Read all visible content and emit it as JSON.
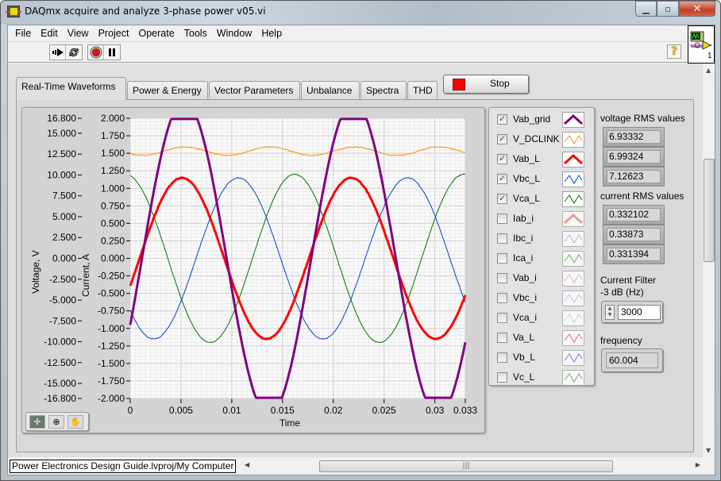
{
  "window": {
    "title": "DAQmx acquire and analyze 3-phase power v05.vi",
    "icon": "labview-vi-icon",
    "controls": {
      "minimize": "minimize-icon",
      "maximize": "maximize-icon",
      "close": "close-icon"
    }
  },
  "menu": [
    "File",
    "Edit",
    "View",
    "Project",
    "Operate",
    "Tools",
    "Window",
    "Help"
  ],
  "toolbar": {
    "buttons": [
      "run-arrow-icon",
      "run-continuously-icon",
      "abort-icon",
      "pause-icon"
    ],
    "help": "?",
    "connector_number": "1"
  },
  "tabs": [
    {
      "label": "Real-Time Waveforms",
      "active": true
    },
    {
      "label": "Power & Energy",
      "active": false
    },
    {
      "label": "Vector Parameters",
      "active": false
    },
    {
      "label": "Unbalance",
      "active": false
    },
    {
      "label": "Spectra",
      "active": false
    },
    {
      "label": "THD",
      "active": false
    }
  ],
  "stop_button": {
    "label": "Stop",
    "led_color": "#ff0000"
  },
  "graph": {
    "palette_tools": [
      "cursor-tool-icon",
      "zoom-tool-icon",
      "pan-hand-icon"
    ]
  },
  "chart_data": {
    "type": "line",
    "title": "",
    "xlabel": "Time",
    "ylabel_left": "Voltage, V",
    "ylabel_right": "Current, A",
    "xlim": [
      0,
      0.033
    ],
    "ylim_voltage": [
      -16.8,
      16.8
    ],
    "ylim_current": [
      -2.0,
      2.0
    ],
    "x_ticks": [
      "0",
      "0.005",
      "0.01",
      "0.015",
      "0.02",
      "0.025",
      "0.03",
      "0.033"
    ],
    "y_ticks_voltage": [
      "16.800",
      "15.000",
      "12.500",
      "10.000",
      "7.500",
      "5.000",
      "2.500",
      "0.000",
      "-2.500",
      "-5.000",
      "-7.500",
      "-10.000",
      "-12.500",
      "-15.000",
      "-16.800"
    ],
    "y_ticks_current": [
      "2.000",
      "1.750",
      "1.500",
      "1.250",
      "1.000",
      "0.750",
      "0.500",
      "0.250",
      "0.000",
      "-0.250",
      "-0.500",
      "-0.750",
      "-1.000",
      "-1.250",
      "-1.500",
      "-1.750",
      "-2.000"
    ],
    "grid": true,
    "frequency_hz": 60.004,
    "series": [
      {
        "name": "Vab_grid",
        "color": "#800080",
        "axis": "current",
        "amplitude": 2.0,
        "offset": 0,
        "phase_deg": -25,
        "clipped": true,
        "width": 3
      },
      {
        "name": "V_DCLINK",
        "color": "#ff8c00",
        "axis": "current",
        "amplitude": 0.06,
        "offset": 1.53,
        "phase_deg": 0,
        "harmonic": 2,
        "width": 1
      },
      {
        "name": "Vab_L",
        "color": "#ff0000",
        "axis": "current",
        "amplitude": 1.15,
        "offset": 0,
        "phase_deg": -20,
        "width": 3
      },
      {
        "name": "Vbc_L",
        "color": "#0040d0",
        "axis": "current",
        "amplitude": 1.15,
        "offset": 0,
        "phase_deg": -140,
        "width": 1
      },
      {
        "name": "Vca_L",
        "color": "#007000",
        "axis": "current",
        "amplitude": 1.2,
        "offset": 0,
        "phase_deg": 100,
        "width": 1
      }
    ]
  },
  "legend": [
    {
      "name": "Vab_grid",
      "checked": true,
      "color": "#800080",
      "style": "thick"
    },
    {
      "name": "V_DCLINK",
      "checked": true,
      "color": "#ff8c00",
      "style": "thin"
    },
    {
      "name": "Vab_L",
      "checked": true,
      "color": "#ff0000",
      "style": "thick"
    },
    {
      "name": "Vbc_L",
      "checked": true,
      "color": "#0040d0",
      "style": "thin"
    },
    {
      "name": "Vca_L",
      "checked": true,
      "color": "#007000",
      "style": "thin"
    },
    {
      "name": "Iab_i",
      "checked": false,
      "color": "#f08080",
      "style": "thick"
    },
    {
      "name": "Ibc_i",
      "checked": false,
      "color": "#8fa8f0",
      "style": "thin"
    },
    {
      "name": "Ica_i",
      "checked": false,
      "color": "#40a040",
      "style": "thin"
    },
    {
      "name": "Vab_i",
      "checked": false,
      "color": "#f0a0a0",
      "style": "thin"
    },
    {
      "name": "Vbc_i",
      "checked": false,
      "color": "#a0b8f0",
      "style": "thin"
    },
    {
      "name": "Vca_i",
      "checked": false,
      "color": "#a0e0a0",
      "style": "thin"
    },
    {
      "name": "Va_L",
      "checked": false,
      "color": "#e04040",
      "style": "thin"
    },
    {
      "name": "Vb_L",
      "checked": false,
      "color": "#4060d0",
      "style": "thin"
    },
    {
      "name": "Vc_L",
      "checked": false,
      "color": "#40a040",
      "style": "thin"
    }
  ],
  "side": {
    "voltage_rms_label": "voltage RMS values",
    "voltage_rms": [
      "6.93332",
      "6.99324",
      "7.12623"
    ],
    "current_rms_label": "current RMS values",
    "current_rms": [
      "0.332102",
      "0.33873",
      "0.331394"
    ],
    "filter_label_1": "Current Filter",
    "filter_label_2": "-3 dB (Hz)",
    "filter_value": "3000",
    "frequency_label": "frequency",
    "frequency_value": "60.004"
  },
  "status": {
    "path": "Power Electronics Design Guide.lvproj/My Computer"
  }
}
